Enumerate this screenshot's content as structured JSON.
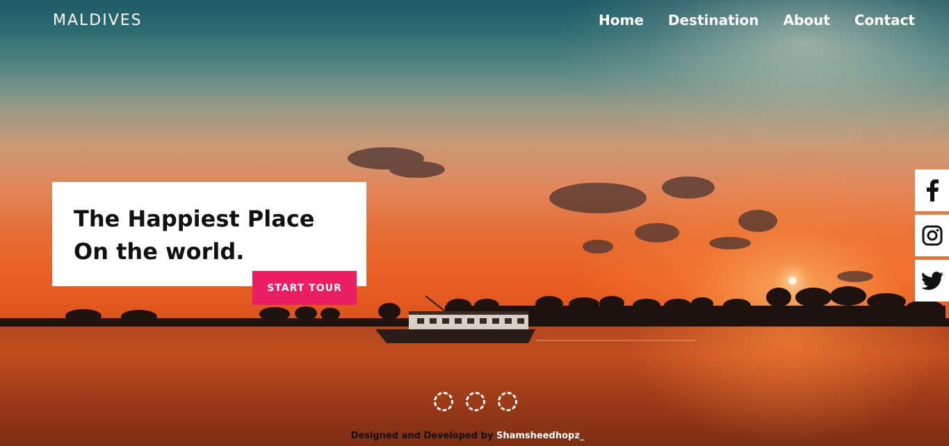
{
  "header": {
    "brand": "MALDIVES",
    "nav": [
      "Home",
      "Destination",
      "About",
      "Contact"
    ]
  },
  "hero": {
    "title_line1": "The Happiest Place",
    "title_line2": "On the world.",
    "cta_label": "START TOUR"
  },
  "social": [
    {
      "icon": "facebook-icon"
    },
    {
      "icon": "instagram-icon"
    },
    {
      "icon": "twitter-icon"
    }
  ],
  "slider": {
    "dot_count": 3
  },
  "footer": {
    "credit_text": "Designed and Developed by ",
    "author": "Shamsheedhopz_"
  },
  "colors": {
    "accent": "#e91e63",
    "text_dark": "#111111",
    "text_light": "#ffffff"
  }
}
